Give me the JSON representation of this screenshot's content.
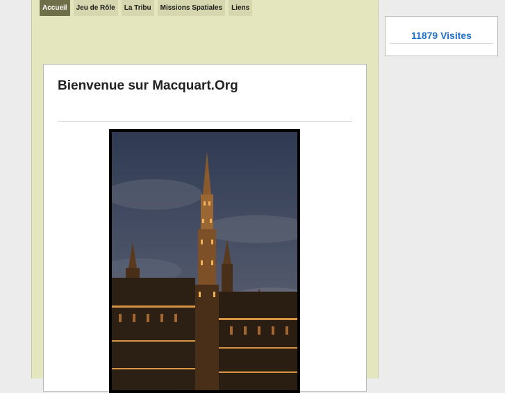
{
  "nav": {
    "tabs": [
      {
        "label": "Accueil",
        "active": true
      },
      {
        "label": "Jeu de Rôle",
        "active": false
      },
      {
        "label": "La Tribu",
        "active": false
      },
      {
        "label": "Missions Spatiales",
        "active": false
      },
      {
        "label": "Liens",
        "active": false
      }
    ]
  },
  "main": {
    "title": "Bienvenue sur Macquart.Org",
    "photo": {
      "subject": "Brussels town hall tower at dusk"
    }
  },
  "sidebar": {
    "counter_text": "11879 Visites"
  },
  "colors": {
    "page_background": "#ececec",
    "column_background": "#e4e6bd",
    "active_tab": "#6f6f4a",
    "tab": "#d6d7ae",
    "counter_link": "#1f6fc9"
  }
}
